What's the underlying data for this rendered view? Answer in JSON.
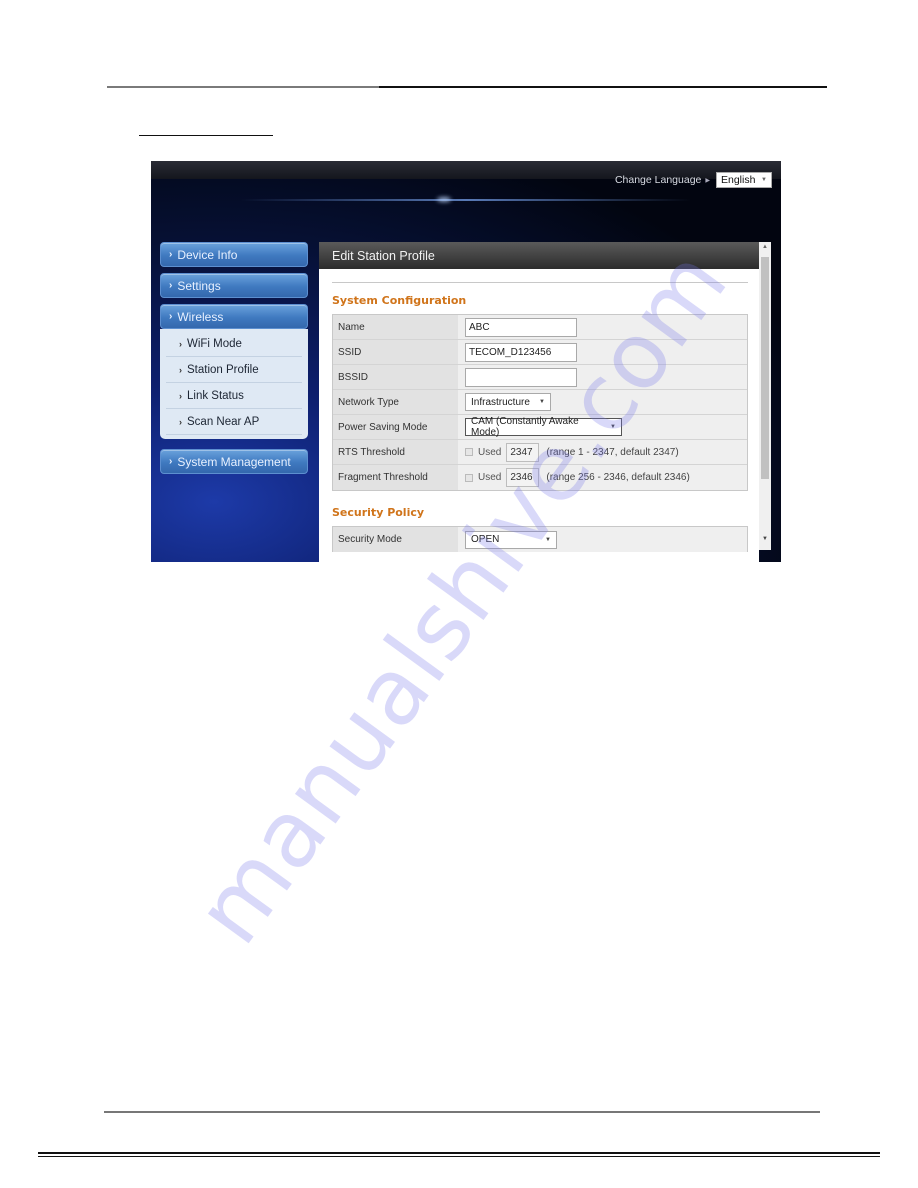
{
  "document": {
    "watermark": "manualshive.com"
  },
  "screen": {
    "language": {
      "label": "Change Language",
      "arrow_icon": "triangle-right",
      "selected": "English"
    },
    "sidebar": {
      "items": [
        {
          "label": "Device Info"
        },
        {
          "label": "Settings"
        },
        {
          "label": "Wireless",
          "expanded": true,
          "children": [
            {
              "label": "WiFi Mode"
            },
            {
              "label": "Station Profile"
            },
            {
              "label": "Link Status"
            },
            {
              "label": "Scan Near AP"
            }
          ]
        },
        {
          "label": "System Management"
        }
      ]
    },
    "panel": {
      "title": "Edit Station Profile",
      "sections": {
        "system": {
          "title": "System Configuration",
          "rows": {
            "name": {
              "label": "Name",
              "value": "ABC"
            },
            "ssid": {
              "label": "SSID",
              "value": "TECOM_D123456"
            },
            "bssid": {
              "label": "BSSID",
              "value": ""
            },
            "network_type": {
              "label": "Network Type",
              "selected": "Infrastructure"
            },
            "power_saving": {
              "label": "Power Saving Mode",
              "selected": "CAM (Constantly Awake Mode)"
            },
            "rts": {
              "label": "RTS Threshold",
              "used_label": "Used",
              "used_checked": false,
              "value": "2347",
              "hint": "(range 1 - 2347, default 2347)"
            },
            "fragment": {
              "label": "Fragment Threshold",
              "used_label": "Used",
              "used_checked": false,
              "value": "2346",
              "hint": "(range 256 - 2346, default 2346)"
            }
          }
        },
        "security": {
          "title": "Security Policy",
          "rows": {
            "mode": {
              "label": "Security Mode",
              "selected": "OPEN"
            }
          }
        }
      }
    },
    "colors": {
      "section_title": "#d0741a",
      "nav_button": "#3f79c0",
      "submenu_bg": "#dfe9f4",
      "header_bg": "#2c2c2c"
    }
  }
}
